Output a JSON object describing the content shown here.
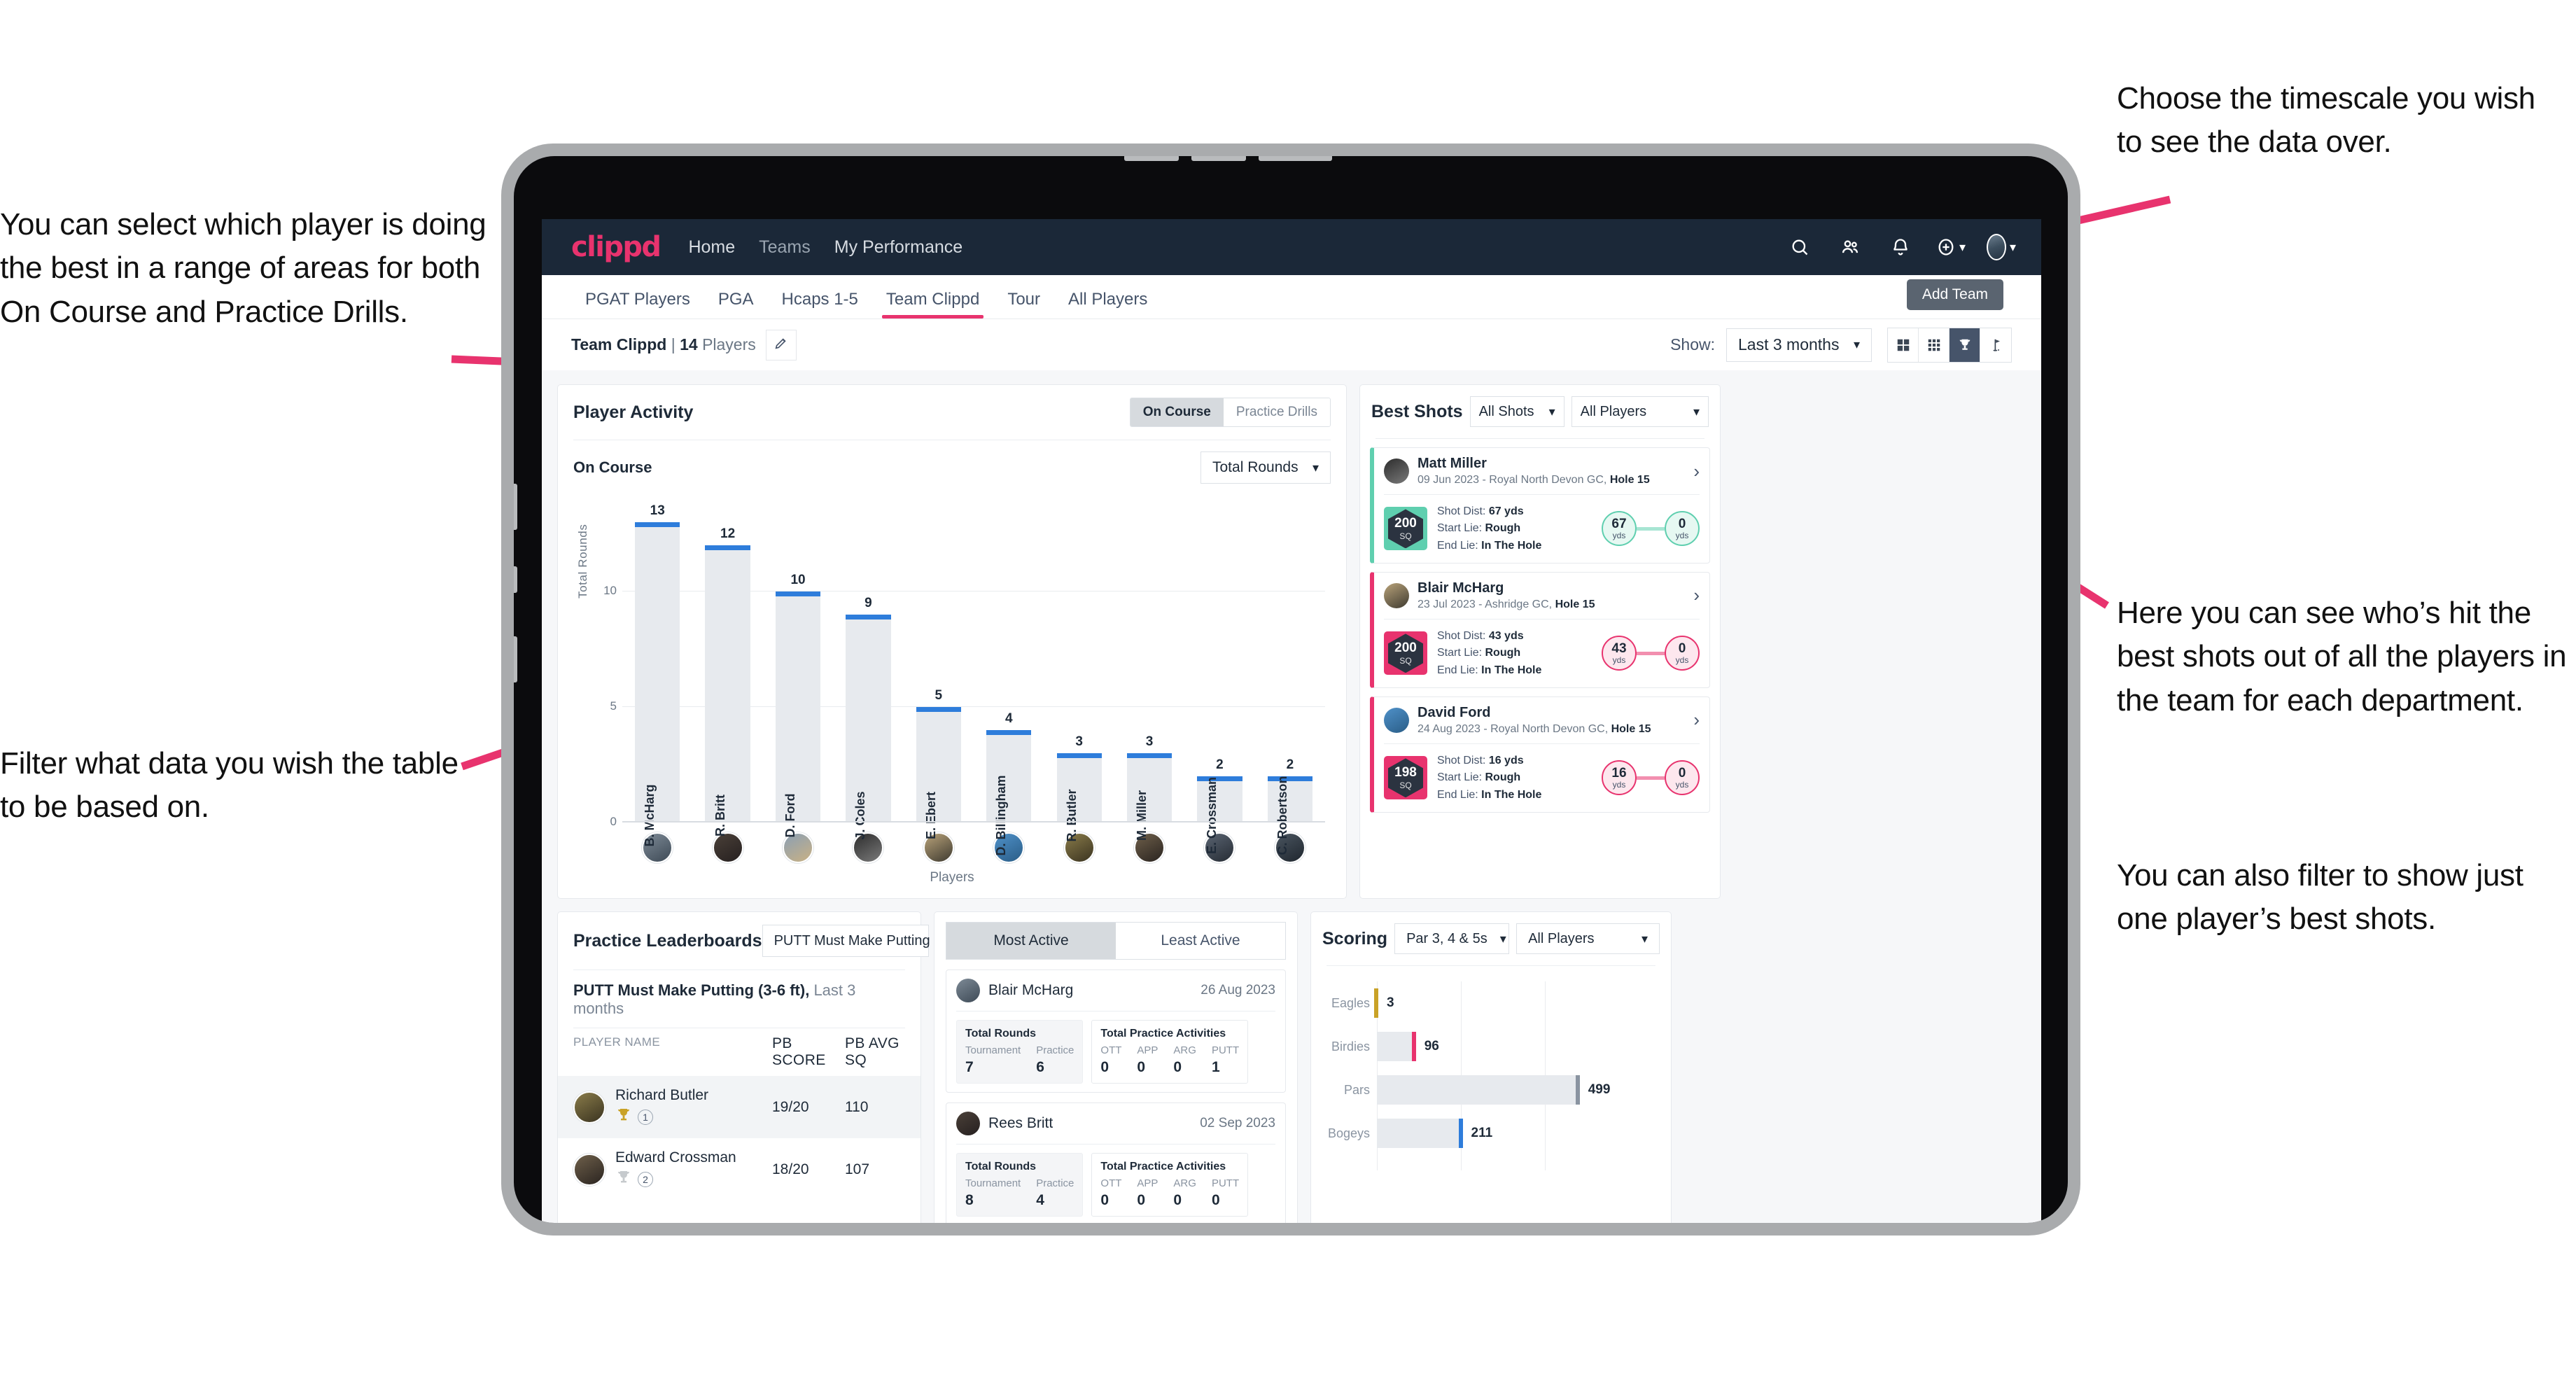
{
  "annotations": {
    "left_top": "You can select which player is doing the best in a range of areas for both On Course and Practice Drills.",
    "left_bottom": "Filter what data you wish the table to be based on.",
    "right_top": "Choose the timescale you wish to see the data over.",
    "right_middle": "Here you can see who’s hit the best shots out of all the players in the team for each department.",
    "right_bottom": "You can also filter to show just one player’s best shots."
  },
  "topnav": {
    "brand": "clippd",
    "links": [
      "Home",
      "Teams",
      "My Performance"
    ],
    "icons": [
      "search-icon",
      "people-icon",
      "bell-icon",
      "plus-circle-icon",
      "avatar-icon"
    ]
  },
  "tabs": {
    "items": [
      "PGAT Players",
      "PGA",
      "Hcaps 1-5",
      "Team Clippd",
      "Tour",
      "All Players"
    ],
    "active": "Team Clippd",
    "tooltip": "Add Team"
  },
  "subheader": {
    "team_name": "Team Clippd",
    "separator": "|",
    "player_count": "14",
    "players_word": "Players",
    "edit_icon": "pencil-icon",
    "show_label": "Show:",
    "timescale": "Last 3 months",
    "view_toggles": [
      "grid-large-icon",
      "grid-small-icon",
      "trophy-icon",
      "flag-icon"
    ],
    "active_view": "trophy-icon"
  },
  "player_activity": {
    "title": "Player Activity",
    "segmented": {
      "options": [
        "On Course",
        "Practice Drills"
      ],
      "selected": "On Course"
    },
    "subtitle": "On Course",
    "metric_select": "Total Rounds",
    "chart_data": {
      "type": "bar",
      "title": "Player Activity — On Course",
      "xlabel": "Players",
      "ylabel": "Total Rounds",
      "ylim": [
        0,
        14
      ],
      "yticks": [
        0,
        5,
        10
      ],
      "grid": true,
      "categories": [
        "B. McHarg",
        "R. Britt",
        "D. Ford",
        "J. Coles",
        "E. Ebert",
        "D. Billingham",
        "R. Butler",
        "M. Miller",
        "E. Crossman",
        "C. Robertson"
      ],
      "values": [
        13,
        12,
        10,
        9,
        5,
        4,
        3,
        3,
        2,
        2
      ]
    }
  },
  "best_shots": {
    "title": "Best Shots",
    "shot_filter": "All Shots",
    "player_filter": "All Players",
    "cards": [
      {
        "player": "Matt Miller",
        "meta_date": "09 Jun 2023",
        "meta_sep": " - ",
        "course": "Royal North Devon GC,",
        "hole": "Hole 15",
        "sq_value": "200",
        "sq_unit": "SQ",
        "shot_dist_label": "Shot Dist:",
        "shot_dist_value": "67 yds",
        "start_lie_label": "Start Lie:",
        "start_lie_value": "Rough",
        "end_lie_label": "End Lie:",
        "end_lie_value": "In The Hole",
        "start_yds": "67",
        "end_yds": "0",
        "unit": "yds",
        "accent": "#5fcfaf"
      },
      {
        "player": "Blair McHarg",
        "meta_date": "23 Jul 2023",
        "meta_sep": " - ",
        "course": "Ashridge GC,",
        "hole": "Hole 15",
        "sq_value": "200",
        "sq_unit": "SQ",
        "shot_dist_label": "Shot Dist:",
        "shot_dist_value": "43 yds",
        "start_lie_label": "Start Lie:",
        "start_lie_value": "Rough",
        "end_lie_label": "End Lie:",
        "end_lie_value": "In The Hole",
        "start_yds": "43",
        "end_yds": "0",
        "unit": "yds",
        "accent": "#e8336e"
      },
      {
        "player": "David Ford",
        "meta_date": "24 Aug 2023",
        "meta_sep": " - ",
        "course": "Royal North Devon GC,",
        "hole": "Hole 15",
        "sq_value": "198",
        "sq_unit": "SQ",
        "shot_dist_label": "Shot Dist:",
        "shot_dist_value": "16 yds",
        "start_lie_label": "Start Lie:",
        "start_lie_value": "Rough",
        "end_lie_label": "End Lie:",
        "end_lie_value": "In The Hole",
        "start_yds": "16",
        "end_yds": "0",
        "unit": "yds",
        "accent": "#e8336e"
      }
    ]
  },
  "practice_leaderboards": {
    "title": "Practice Leaderboards",
    "drill_select": "PUTT Must Make Putting ...",
    "subtitle_bold": "PUTT Must Make Putting (3-6 ft),",
    "subtitle_muted": " Last 3 months",
    "columns": [
      "PLAYER NAME",
      "PB SCORE",
      "PB AVG SQ"
    ],
    "rows": [
      {
        "name": "Richard Butler",
        "rank": "1",
        "trophy": "gold",
        "pb_score": "19/20",
        "pb_avg_sq": "110"
      },
      {
        "name": "Edward Crossman",
        "rank": "2",
        "trophy": "silver",
        "pb_score": "18/20",
        "pb_avg_sq": "107"
      }
    ]
  },
  "activity": {
    "tabs": [
      "Most Active",
      "Least Active"
    ],
    "active_tab": "Most Active",
    "rounds_title": "Total Rounds",
    "rounds_keys": [
      "Tournament",
      "Practice"
    ],
    "practice_title": "Total Practice Activities",
    "practice_keys": [
      "OTT",
      "APP",
      "ARG",
      "PUTT"
    ],
    "cards": [
      {
        "name": "Blair McHarg",
        "date": "26 Aug 2023",
        "rounds": [
          "7",
          "6"
        ],
        "practice": [
          "0",
          "0",
          "0",
          "1"
        ]
      },
      {
        "name": "Rees Britt",
        "date": "02 Sep 2023",
        "rounds": [
          "8",
          "4"
        ],
        "practice": [
          "0",
          "0",
          "0",
          "0"
        ]
      }
    ]
  },
  "scoring": {
    "title": "Scoring",
    "par_select": "Par 3, 4 & 5s",
    "player_select": "All Players",
    "chart_data": {
      "type": "bar",
      "orientation": "horizontal",
      "title": "Scoring",
      "categories": [
        "Eagles",
        "Birdies",
        "Pars",
        "Bogeys"
      ],
      "values": [
        3,
        96,
        499,
        211
      ],
      "colors": [
        "#c9a227",
        "#e8336e",
        "#8a94a1",
        "#2e7ddb"
      ],
      "xlim": [
        0,
        620
      ],
      "grid": true
    }
  },
  "colors": {
    "brand_pink": "#e8336e",
    "nav_dark": "#1b2838",
    "bar_blue": "#2e7ddb",
    "bar_fill": "#e7eaee"
  }
}
